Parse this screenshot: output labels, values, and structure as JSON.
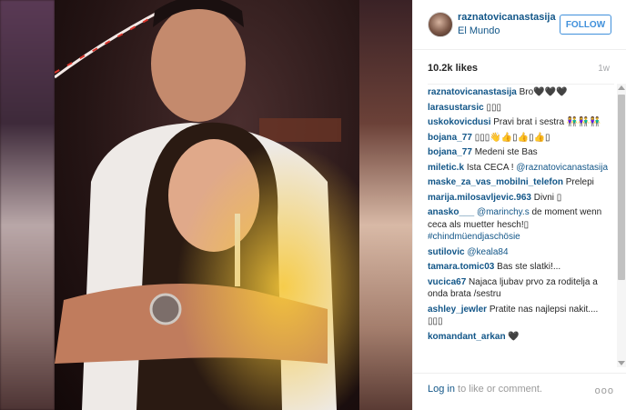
{
  "post": {
    "image_alt": "",
    "account": {
      "username": "raznatovicanastasija",
      "location": "El Mundo",
      "follow_label": "FOLLOW"
    },
    "likes": "10.2k likes",
    "age": "1w",
    "comments": [
      {
        "user": "raznatovicanastasija",
        "text": "Bro🖤🖤🖤"
      },
      {
        "user": "larasustarsic",
        "text": "▯▯▯"
      },
      {
        "user": "uskokovicdusi",
        "text": "Pravi brat i sestra 👫👫👫"
      },
      {
        "user": "bojana_77",
        "text": "▯▯▯👋👍▯👍▯👍▯"
      },
      {
        "user": "bojana_77",
        "text": "Medeni ste Bas"
      },
      {
        "user": "miletic.k",
        "text": "Ista CECA !",
        "mention": "@raznatovicanastasija"
      },
      {
        "user": "maske_za_vas_mobilni_telefon",
        "text": "Prelepi"
      },
      {
        "user": "marija.milosavljevic.963",
        "text": "Divni ▯"
      },
      {
        "user": "anasko___",
        "mention": "@marinchy.s",
        "text": "de moment wenn ceca als muetter hesch!▯",
        "tag": "#chindmüendjaschösie"
      },
      {
        "user": "sutilovic",
        "mention": "@keala84",
        "text": ""
      },
      {
        "user": "tamara.tomic03",
        "text": "Bas ste slatki!..."
      },
      {
        "user": "vucica67",
        "text": "Najaca ljubav prvo za roditelja a onda brata /sestru"
      },
      {
        "user": "ashley_jewler",
        "text": "Pratite nas najlepsi nakit.... ▯▯▯"
      },
      {
        "user": "komandant_arkan",
        "text": "🖤"
      }
    ],
    "footer": {
      "login_link": "Log in",
      "login_rest": " to like or comment.",
      "more": "ooo"
    }
  }
}
